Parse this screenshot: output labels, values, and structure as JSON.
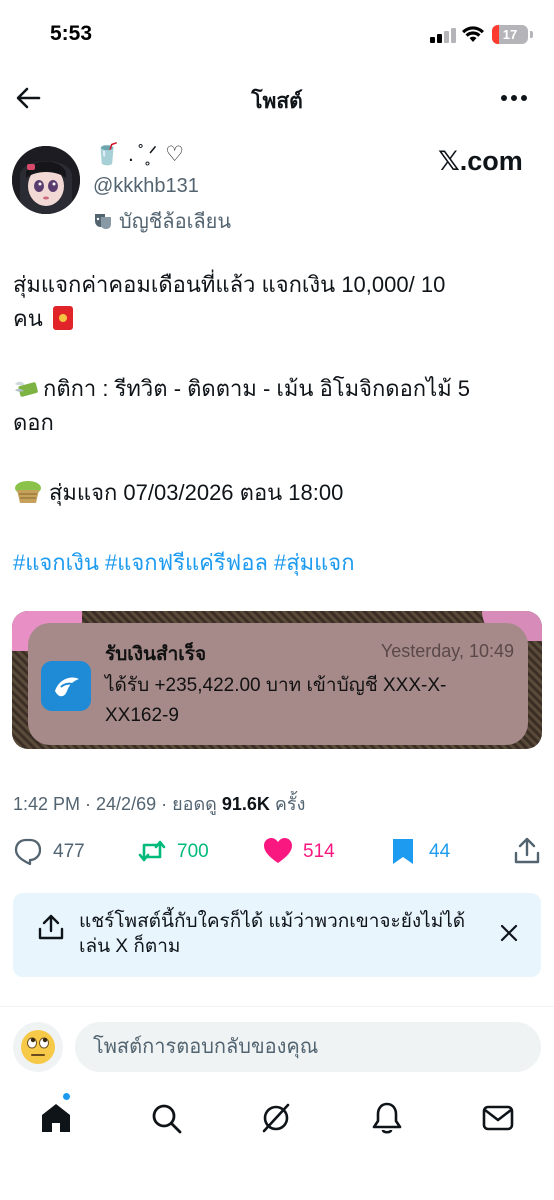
{
  "status_bar": {
    "time": "5:53",
    "battery": "17",
    "battery_color": "#ff3b30"
  },
  "header": {
    "title": "โพสต์"
  },
  "author": {
    "display_name": "🥤 . ̊ ̥ᐟ ♡",
    "handle": "@kkkhb131",
    "parody_label": "บัญชีล้อเลียน"
  },
  "source_badge": "𝕏.com",
  "post": {
    "line1": "สุ่มแจกค่าคอมเดือนที่แล้ว  แจกเงิน 10,000/ 10",
    "line2": "คน",
    "line3": "กติกา : รีทวิต - ติดตาม - เม้น อิโมจิกดอกไม้ 5",
    "line4": "ดอก",
    "line5": "สุ่มแจก 07/03/2026 ตอน 18:00",
    "hashtags": [
      "#แจกเงิน",
      "#แจกฟรีแค่รีฟอล",
      "#สุ่มแจก"
    ]
  },
  "media_notification": {
    "title": "รับเงินสำเร็จ",
    "time": "Yesterday, 10:49",
    "body": "ได้รับ +235,422.00 บาท เข้าบัญชี XXX-X-XX162-9"
  },
  "meta": {
    "time_date": "1:42 PM · 24/2/69 · ยอดดู ",
    "views": "91.6K",
    "views_suffix": " ครั้ง"
  },
  "actions": {
    "replies": "477",
    "reposts": "700",
    "likes": "514",
    "bookmarks": "44"
  },
  "colors": {
    "repost": "#00ba7c",
    "like": "#f91880",
    "bookmark": "#1d9bf0",
    "link": "#1d9bf0"
  },
  "share_banner": {
    "text": "แชร์โพสต์นี้กับใครก็ได้ แม้ว่าพวกเขาจะยังไม่ได้เล่น X ก็ตาม"
  },
  "reply": {
    "placeholder": "โพสต์การตอบกลับของคุณ",
    "avatar_emoji": "🙄"
  },
  "nav": [
    "home-icon",
    "search-icon",
    "grok-icon",
    "notifications-icon",
    "messages-icon"
  ]
}
